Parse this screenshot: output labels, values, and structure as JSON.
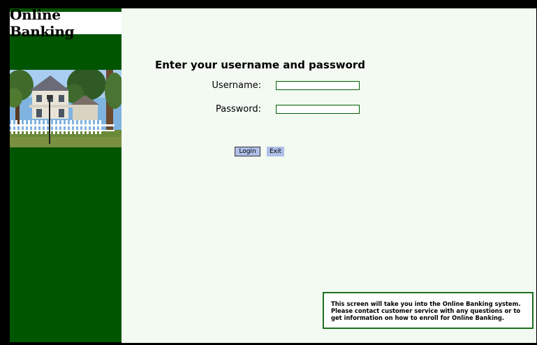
{
  "brand": {
    "title": "Online Banking"
  },
  "login": {
    "heading": "Enter your username and password",
    "username_label": "Username:",
    "username_value": "",
    "password_label": "Password:",
    "password_value": "",
    "login_button": "Login",
    "exit_button": "Exit"
  },
  "info": {
    "text": "This screen will take you into the Online Banking system. Please contact customer service with any questions or to get information on how to enroll for Online Banking."
  },
  "colors": {
    "sidebar": "#005500",
    "main_bg": "#f2faf2",
    "button_bg": "#b0bfe9",
    "info_border": "#1e6e1e"
  },
  "images": {
    "sidebar_photo": "house-with-white-picket-fence"
  }
}
